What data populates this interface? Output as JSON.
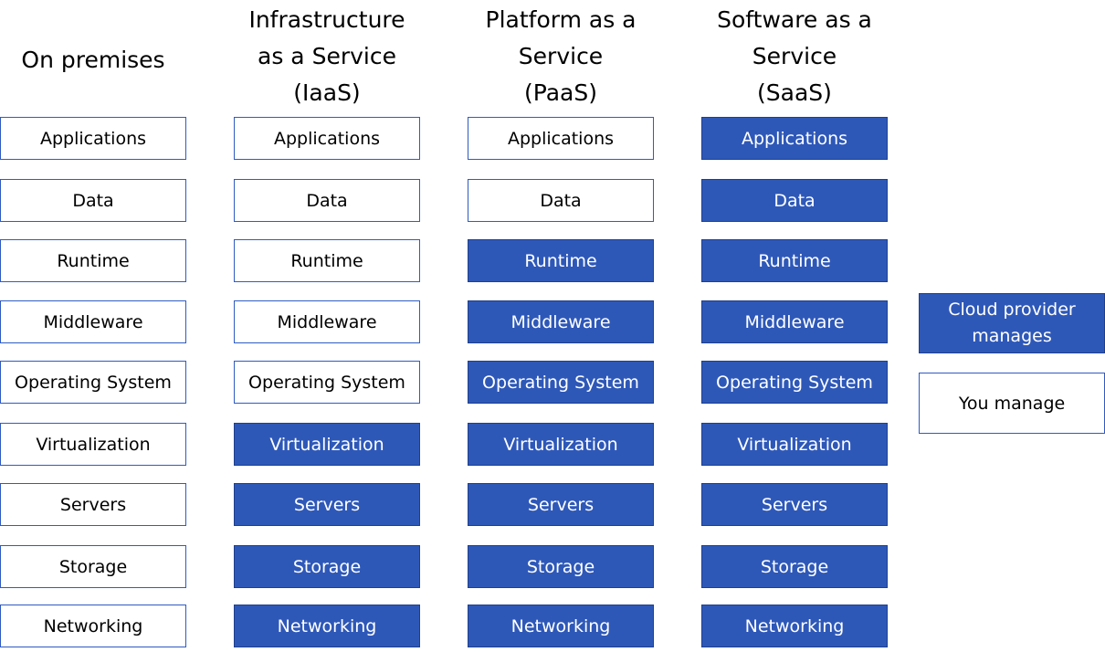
{
  "columns": [
    {
      "title": "On premises",
      "layers": [
        {
          "label": "Applications",
          "managed_by": "you"
        },
        {
          "label": "Data",
          "managed_by": "you"
        },
        {
          "label": "Runtime",
          "managed_by": "you"
        },
        {
          "label": "Middleware",
          "managed_by": "you"
        },
        {
          "label": "Operating System",
          "managed_by": "you"
        },
        {
          "label": "Virtualization",
          "managed_by": "you"
        },
        {
          "label": "Servers",
          "managed_by": "you"
        },
        {
          "label": "Storage",
          "managed_by": "you"
        },
        {
          "label": "Networking",
          "managed_by": "you"
        }
      ]
    },
    {
      "title": "Infrastructure\nas a Service\n(IaaS)",
      "layers": [
        {
          "label": "Applications",
          "managed_by": "you"
        },
        {
          "label": "Data",
          "managed_by": "you"
        },
        {
          "label": "Runtime",
          "managed_by": "you"
        },
        {
          "label": "Middleware",
          "managed_by": "you"
        },
        {
          "label": "Operating System",
          "managed_by": "you"
        },
        {
          "label": "Virtualization",
          "managed_by": "cloud"
        },
        {
          "label": "Servers",
          "managed_by": "cloud"
        },
        {
          "label": "Storage",
          "managed_by": "cloud"
        },
        {
          "label": "Networking",
          "managed_by": "cloud"
        }
      ]
    },
    {
      "title": "Platform as a\nService\n(PaaS)",
      "layers": [
        {
          "label": "Applications",
          "managed_by": "you"
        },
        {
          "label": "Data",
          "managed_by": "you"
        },
        {
          "label": "Runtime",
          "managed_by": "cloud"
        },
        {
          "label": "Middleware",
          "managed_by": "cloud"
        },
        {
          "label": "Operating System",
          "managed_by": "cloud"
        },
        {
          "label": "Virtualization",
          "managed_by": "cloud"
        },
        {
          "label": "Servers",
          "managed_by": "cloud"
        },
        {
          "label": "Storage",
          "managed_by": "cloud"
        },
        {
          "label": "Networking",
          "managed_by": "cloud"
        }
      ]
    },
    {
      "title": "Software as a\nService\n(SaaS)",
      "layers": [
        {
          "label": "Applications",
          "managed_by": "cloud"
        },
        {
          "label": "Data",
          "managed_by": "cloud"
        },
        {
          "label": "Runtime",
          "managed_by": "cloud"
        },
        {
          "label": "Middleware",
          "managed_by": "cloud"
        },
        {
          "label": "Operating System",
          "managed_by": "cloud"
        },
        {
          "label": "Virtualization",
          "managed_by": "cloud"
        },
        {
          "label": "Servers",
          "managed_by": "cloud"
        },
        {
          "label": "Storage",
          "managed_by": "cloud"
        },
        {
          "label": "Networking",
          "managed_by": "cloud"
        }
      ]
    }
  ],
  "legend": {
    "cloud": "Cloud provider\nmanages",
    "you": "You manage"
  },
  "colors": {
    "cloud_fill": "#2E58B8",
    "cloud_border": "#1F3F8A",
    "you_border": "#2F5BC0"
  }
}
